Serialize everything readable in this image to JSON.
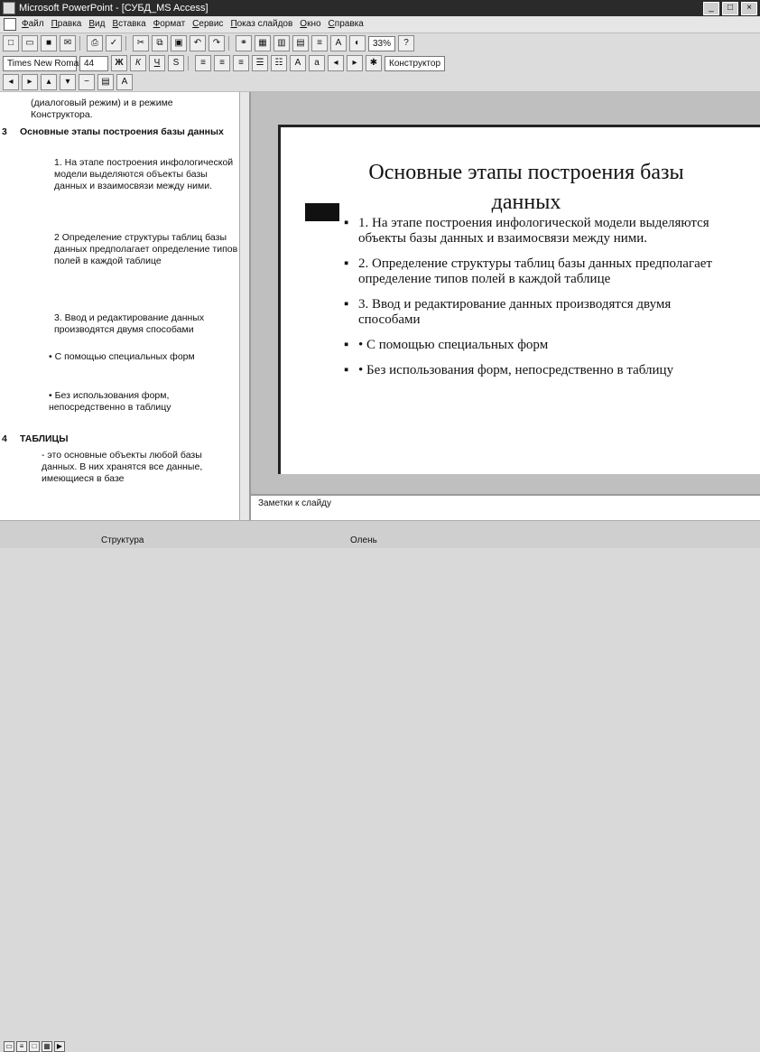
{
  "window": {
    "title": "Microsoft PowerPoint - [СУБД_MS Access]",
    "controls": [
      "_",
      "□",
      "×"
    ]
  },
  "menu": {
    "items": [
      "Файл",
      "Правка",
      "Вид",
      "Вставка",
      "Формат",
      "Сервис",
      "Показ слайдов",
      "Окно",
      "Справка"
    ]
  },
  "toolbar": {
    "zoom": "33%",
    "font_name": "Times New Roman",
    "font_size": "44",
    "design_label": "Конструктор"
  },
  "outline": {
    "intro_line1": "(диалоговый режим) и в режиме",
    "intro_line2": "Конструктора.",
    "slide3_number": "3",
    "slide3_title": "Основные этапы построения базы данных",
    "bullets": [
      "1.      На этапе построения инфологической модели выделяются объекты базы данных и взаимосвязи между ними.",
      "2      Определение структуры таблиц базы данных предполагает определение типов полей в каждой таблице",
      "3.      Ввод и редактирование данных производятся двумя способами"
    ],
    "sub_bullets": [
      "•         С помощью специальных форм",
      "•         Без использования форм, непосредственно в таблицу"
    ],
    "slide4_number": "4",
    "slide4_title": "ТАБЛИЦЫ",
    "slide4_text": "- это основные объекты любой базы данных. В них хранятся все данные, имеющиеся в базе"
  },
  "slide": {
    "title": "Основные этапы построения базы данных",
    "bullets": [
      "1.     На этапе построения инфологической модели выделяются объекты базы данных и взаимосвязи между ними.",
      "2.     Определение структуры таблиц базы данных предполагает определение типов полей в каждой таблице",
      "3.     Ввод и редактирование данных производятся двумя способами",
      "•        С помощью специальных форм",
      "•        Без использования форм, непосредственно в таблицу"
    ]
  },
  "notes": {
    "placeholder": "Заметки к слайду"
  },
  "status": {
    "left_tab": "Структура",
    "right_tab": "Олень"
  }
}
